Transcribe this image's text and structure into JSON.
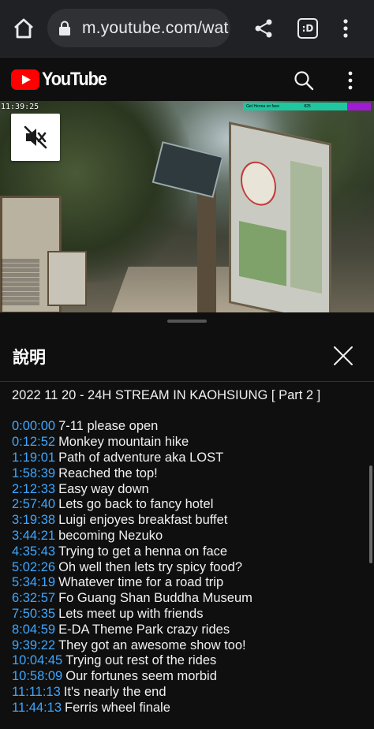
{
  "browser": {
    "url": "m.youtube.com/wat",
    "tabs_label": ":D",
    "icons": [
      "home-icon",
      "lock-icon",
      "share-icon",
      "tabs-icon",
      "more-vert-icon"
    ]
  },
  "header": {
    "logo_text": "YouTube",
    "icons": [
      "search-icon",
      "more-vert-icon"
    ]
  },
  "video": {
    "overlay_time": "11:39:25",
    "overlay_goal_text": "Get Henna on face",
    "overlay_goal_amount": "825",
    "muted": true
  },
  "description": {
    "title": "說明",
    "headline": "2022 11 20 - 24H STREAM IN KAOHSIUNG [ Part 2 ]",
    "chapters": [
      {
        "time": "0:00:00",
        "title": "7-11 please open"
      },
      {
        "time": "0:12:52",
        "title": "Monkey mountain hike"
      },
      {
        "time": "1:19:01",
        "title": "Path of adventure aka LOST"
      },
      {
        "time": "1:58:39",
        "title": "Reached the top!"
      },
      {
        "time": "2:12:33",
        "title": "Easy way down"
      },
      {
        "time": "2:57:40",
        "title": "Lets go back to fancy hotel"
      },
      {
        "time": "3:19:38",
        "title": "Luigi enjoyes breakfast buffet"
      },
      {
        "time": "3:44:21",
        "title": "becoming Nezuko"
      },
      {
        "time": "4:35:43",
        "title": "Trying to get a henna on face"
      },
      {
        "time": "5:02:26",
        "title": "Oh well then lets try spicy food?"
      },
      {
        "time": "5:34:19",
        "title": "Whatever time for a road trip"
      },
      {
        "time": "6:32:57",
        "title": "Fo Guang Shan Buddha Museum"
      },
      {
        "time": "7:50:35",
        "title": "Lets meet up with friends"
      },
      {
        "time": "8:04:59",
        "title": "E-DA Theme Park crazy rides"
      },
      {
        "time": "9:39:22",
        "title": "They got an awesome show too!"
      },
      {
        "time": "10:04:45",
        "title": "Trying out rest of the rides"
      },
      {
        "time": "10:58:09",
        "title": "Our fortunes seem morbid"
      },
      {
        "time": "11:11:13",
        "title": "It's nearly the end"
      },
      {
        "time": "11:44:13",
        "title": "Ferris wheel finale"
      }
    ]
  },
  "colors": {
    "background": "#0f0f0f",
    "timestamp_link": "#3ea6ff",
    "youtube_red": "#ff0000"
  }
}
